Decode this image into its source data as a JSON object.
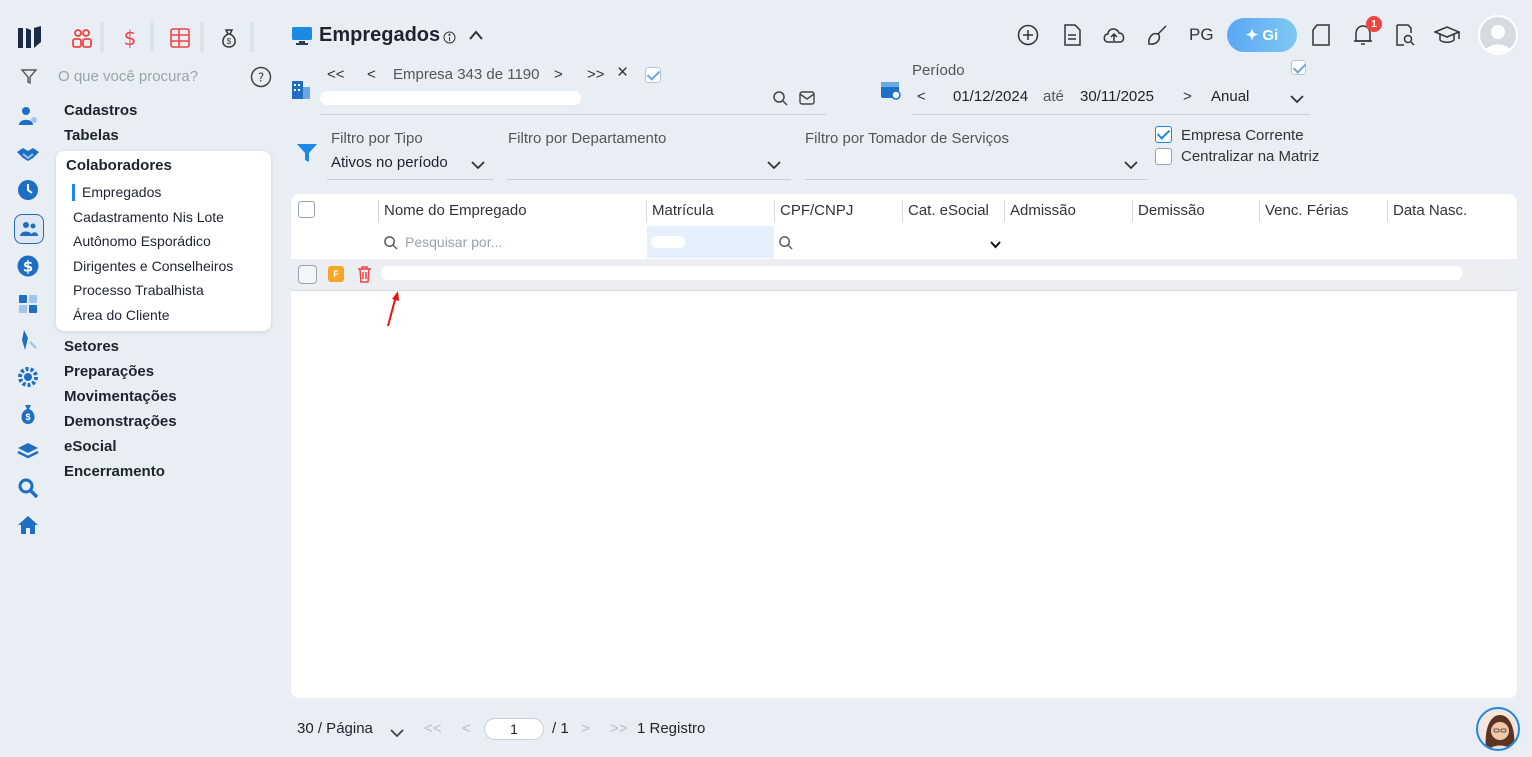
{
  "sidebar": {
    "search_placeholder": "O que você procura?",
    "menu_top": [
      "Cadastros",
      "Tabelas"
    ],
    "submenu": {
      "title": "Colaboradores",
      "items": [
        "Empregados",
        "Cadastramento Nis Lote",
        "Autônomo Esporádico",
        "Dirigentes e Conselheiros",
        "Processo Trabalhista",
        "Área do Cliente"
      ]
    },
    "menu_bottom": [
      "Setores",
      "Preparações",
      "Movimentações",
      "Demonstrações",
      "eSocial",
      "Encerramento"
    ]
  },
  "header": {
    "title": "Empregados",
    "pg_label": "PG",
    "gi_label": "Gi",
    "notification_count": "1"
  },
  "company_nav": {
    "first": "<<",
    "prev": "<",
    "label": "Empresa 343 de 1190",
    "next": ">",
    "last": ">>",
    "clear": "×"
  },
  "period": {
    "label": "Período",
    "start": "01/12/2024",
    "until": "até",
    "end": "30/11/2025",
    "mode": "Anual"
  },
  "filters": {
    "tipo_label": "Filtro por Tipo",
    "tipo_value": "Ativos no período",
    "departamento_label": "Filtro por Departamento",
    "tomador_label": "Filtro por Tomador de Serviços",
    "empresa_corrente": "Empresa Corrente",
    "centralizar": "Centralizar na Matriz"
  },
  "table": {
    "columns": [
      "Nome do Empregado",
      "Matrícula",
      "CPF/CNPJ",
      "Cat. eSocial",
      "Admissão",
      "Demissão",
      "Venc. Férias",
      "Data Nasc."
    ],
    "search_placeholder": "Pesquisar por...",
    "row_badge": "F"
  },
  "pager": {
    "per_page": "30 / Página",
    "page": "1",
    "total_pages": "/ 1",
    "records": "1 Registro"
  },
  "colors": {
    "accent": "#1e88e5",
    "danger": "#ef4444",
    "badge": "#f5a623"
  }
}
